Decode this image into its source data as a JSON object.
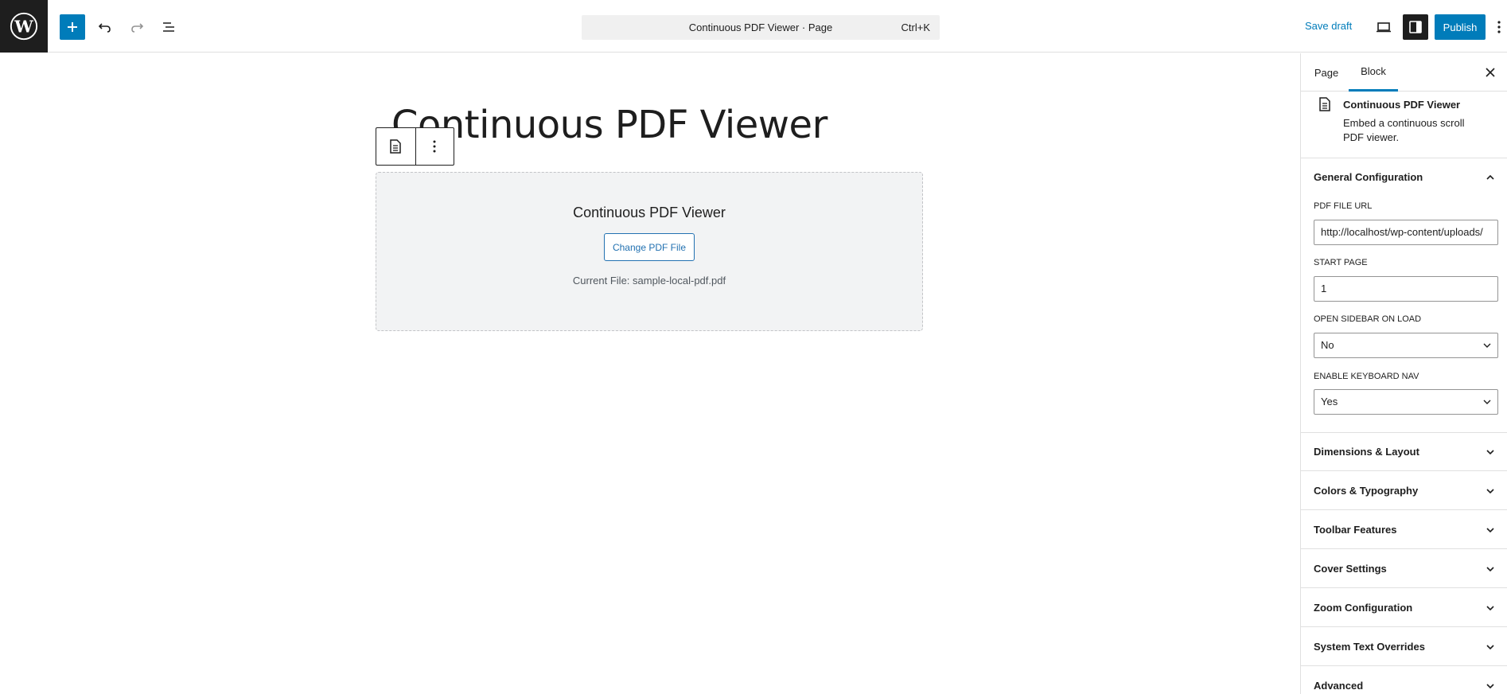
{
  "toolbar": {
    "logo_icon": "wordpress-logo",
    "command_bar_title": "Continuous PDF Viewer · Page",
    "command_bar_shortcut": "Ctrl+K",
    "save_draft_label": "Save draft",
    "publish_label": "Publish",
    "accent_color": "#007cba"
  },
  "canvas": {
    "page_title": "Continuous PDF Viewer",
    "block": {
      "placeholder_title": "Continuous PDF Viewer",
      "change_button_label": "Change PDF File",
      "current_file_text": "Current File: sample-local-pdf.pdf"
    }
  },
  "sidebar": {
    "tabs": [
      {
        "label": "Page",
        "active": false
      },
      {
        "label": "Block",
        "active": true
      }
    ],
    "block_card": {
      "title": "Continuous PDF Viewer",
      "description": "Embed a continuous scroll PDF viewer."
    },
    "general": {
      "title": "General Configuration",
      "expanded": true,
      "fields": {
        "pdf_url_label": "PDF FILE URL",
        "pdf_url_value": "http://localhost/wp-content/uploads/",
        "start_page_label": "START PAGE",
        "start_page_value": "1",
        "sidebar_label": "OPEN SIDEBAR ON LOAD",
        "sidebar_value": "No",
        "keyboard_label": "ENABLE KEYBOARD NAV",
        "keyboard_value": "Yes"
      }
    },
    "panels": [
      {
        "title": "Dimensions & Layout"
      },
      {
        "title": "Colors & Typography"
      },
      {
        "title": "Toolbar Features"
      },
      {
        "title": "Cover Settings"
      },
      {
        "title": "Zoom Configuration"
      },
      {
        "title": "System Text Overrides"
      },
      {
        "title": "Advanced"
      }
    ]
  }
}
